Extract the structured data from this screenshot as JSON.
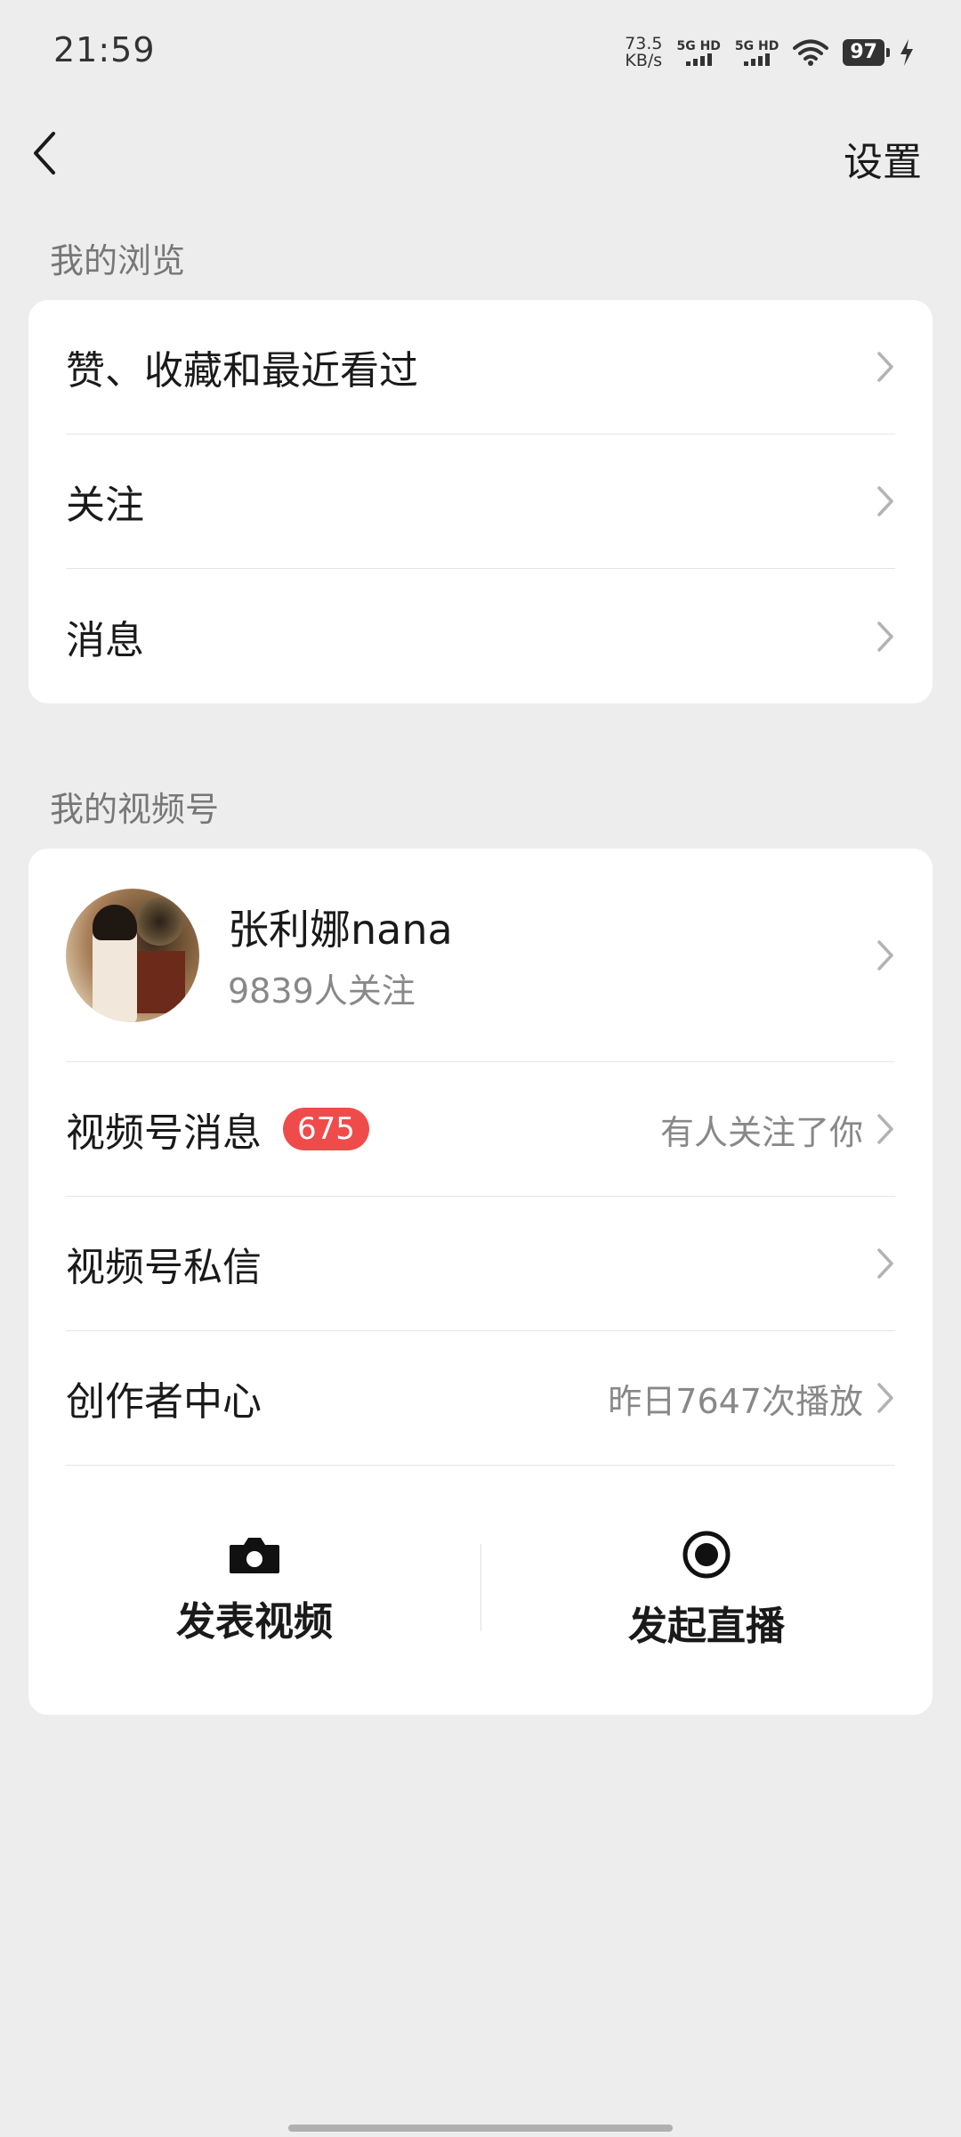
{
  "status_bar": {
    "time": "21:59",
    "net_speed_value": "73.5",
    "net_speed_unit": "KB/s",
    "sim1_label": "5G HD",
    "sim2_label": "5G HD",
    "battery": "97"
  },
  "nav": {
    "back_icon": "chevron-left-icon",
    "settings_label": "设置"
  },
  "browsing": {
    "title": "我的浏览",
    "items": [
      {
        "label": "赞、收藏和最近看过"
      },
      {
        "label": "关注"
      },
      {
        "label": "消息"
      }
    ]
  },
  "channels": {
    "title": "我的视频号",
    "profile": {
      "name": "张利娜nana",
      "followers": "9839人关注"
    },
    "items": [
      {
        "label": "视频号消息",
        "badge": "675",
        "sub": "有人关注了你"
      },
      {
        "label": "视频号私信",
        "sub": ""
      },
      {
        "label": "创作者中心",
        "sub": "昨日7647次播放"
      }
    ],
    "actions": [
      {
        "label": "发表视频",
        "icon": "camera-icon"
      },
      {
        "label": "发起直播",
        "icon": "live-record-icon"
      }
    ]
  },
  "colors": {
    "background": "#ededed",
    "card": "#ffffff",
    "badge": "#f04b4b"
  }
}
